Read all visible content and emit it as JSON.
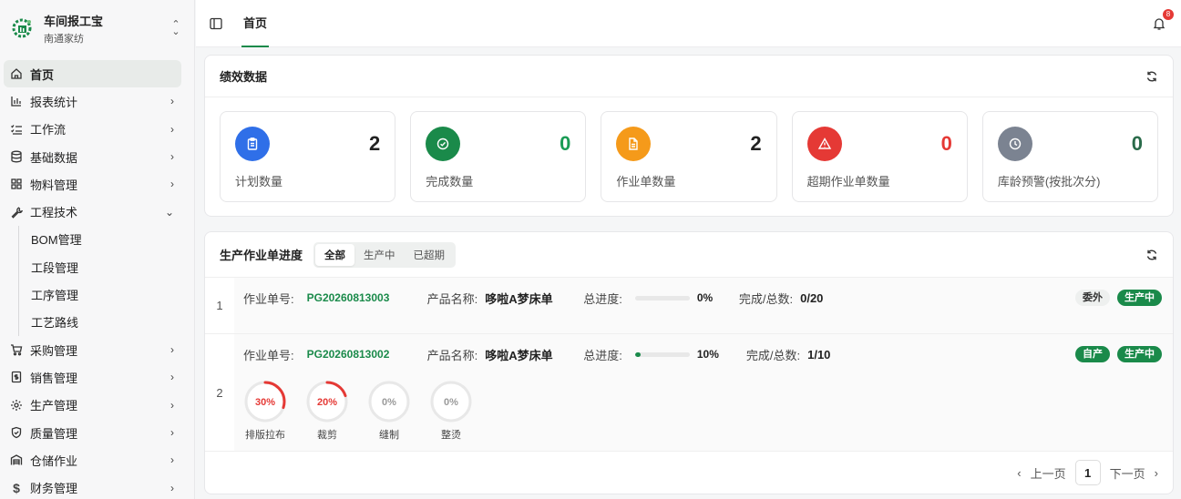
{
  "brand": {
    "title": "车间报工宝",
    "subtitle": "南通家纺"
  },
  "sidebar": {
    "items": [
      {
        "label": "首页",
        "icon": "home-icon"
      },
      {
        "label": "报表统计",
        "icon": "bar-chart-icon"
      },
      {
        "label": "工作流",
        "icon": "list-check-icon"
      },
      {
        "label": "基础数据",
        "icon": "database-icon"
      },
      {
        "label": "物料管理",
        "icon": "grid-icon"
      },
      {
        "label": "工程技术",
        "icon": "wrench-icon"
      },
      {
        "label": "采购管理",
        "icon": "cart-icon"
      },
      {
        "label": "销售管理",
        "icon": "receipt-icon"
      },
      {
        "label": "生产管理",
        "icon": "gear-icon"
      },
      {
        "label": "质量管理",
        "icon": "shield-icon"
      },
      {
        "label": "仓储作业",
        "icon": "warehouse-icon"
      },
      {
        "label": "财务管理",
        "icon": "dollar-icon"
      }
    ],
    "engineering_sub": [
      "BOM管理",
      "工段管理",
      "工序管理",
      "工艺路线"
    ]
  },
  "topbar": {
    "tab": "首页",
    "notifications": "8"
  },
  "performance": {
    "title": "绩效数据",
    "stats": [
      {
        "value": "2",
        "label": "计划数量",
        "color": "#2f6fe8",
        "value_color": "#222222",
        "icon": "clipboard-icon"
      },
      {
        "value": "0",
        "label": "完成数量",
        "color": "#1a8a4a",
        "value_color": "#1a9b55",
        "icon": "check-circle-icon"
      },
      {
        "value": "2",
        "label": "作业单数量",
        "color": "#f59a1a",
        "value_color": "#222222",
        "icon": "document-icon"
      },
      {
        "value": "0",
        "label": "超期作业单数量",
        "color": "#e53935",
        "value_color": "#e53935",
        "icon": "warning-icon"
      },
      {
        "value": "0",
        "label": "库龄预警(按批次分)",
        "color": "#7b8391",
        "value_color": "#2a6b4a",
        "icon": "clock-icon"
      }
    ]
  },
  "progress": {
    "title": "生产作业单进度",
    "filters": [
      "全部",
      "生产中",
      "已超期"
    ],
    "labels": {
      "order": "作业单号:",
      "product": "产品名称:",
      "progress": "总进度:",
      "done": "完成/总数:"
    },
    "orders": [
      {
        "index": "1",
        "code": "PG20260813003",
        "product": "哆啦A梦床单",
        "percent": 0,
        "percent_text": "0%",
        "done": "0/20",
        "tags": [
          "委外",
          "生产中"
        ]
      },
      {
        "index": "2",
        "code": "PG20260813002",
        "product": "哆啦A梦床单",
        "percent": 10,
        "percent_text": "10%",
        "done": "1/10",
        "tags": [
          "自产",
          "生产中"
        ],
        "steps": [
          {
            "name": "排版拉布",
            "percent": 30,
            "text": "30%"
          },
          {
            "name": "裁剪",
            "percent": 20,
            "text": "20%"
          },
          {
            "name": "缝制",
            "percent": 0,
            "text": "0%"
          },
          {
            "name": "整烫",
            "percent": 0,
            "text": "0%"
          }
        ]
      }
    ]
  },
  "pager": {
    "prev": "上一页",
    "page": "1",
    "next": "下一页"
  }
}
